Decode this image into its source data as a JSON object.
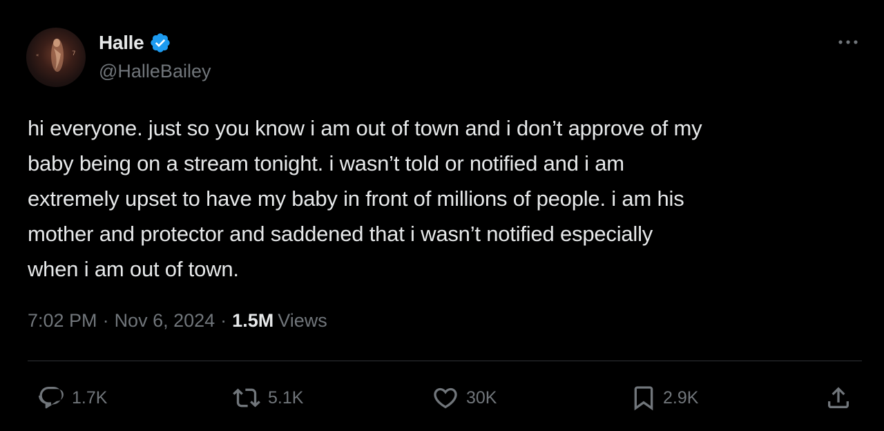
{
  "author": {
    "display_name": "Halle",
    "handle": "@HalleBailey",
    "verified": true,
    "verified_color": "#1d9bf0"
  },
  "tweet": {
    "text": "hi everyone. just so you know i am out of town and i don’t approve of my\nbaby being on a stream tonight. i wasn’t told or notified and i am\nextremely upset to have my baby in front of millions of people. i am his\nmother and protector and saddened that i wasn’t notified especially\nwhen i am out of town.",
    "time": "7:02 PM",
    "date": "Nov 6, 2024",
    "separator": "·",
    "views_count": "1.5M",
    "views_label": "Views"
  },
  "actions": {
    "reply": {
      "icon": "reply-icon",
      "count": "1.7K"
    },
    "retweet": {
      "icon": "retweet-icon",
      "count": "5.1K"
    },
    "like": {
      "icon": "heart-icon",
      "count": "30K"
    },
    "bookmark": {
      "icon": "bookmark-icon",
      "count": "2.9K"
    },
    "share": {
      "icon": "share-icon"
    }
  },
  "theme": {
    "background": "#000000",
    "text_primary": "#e7e9ea",
    "text_secondary": "#71767b",
    "divider": "#2f3336"
  }
}
